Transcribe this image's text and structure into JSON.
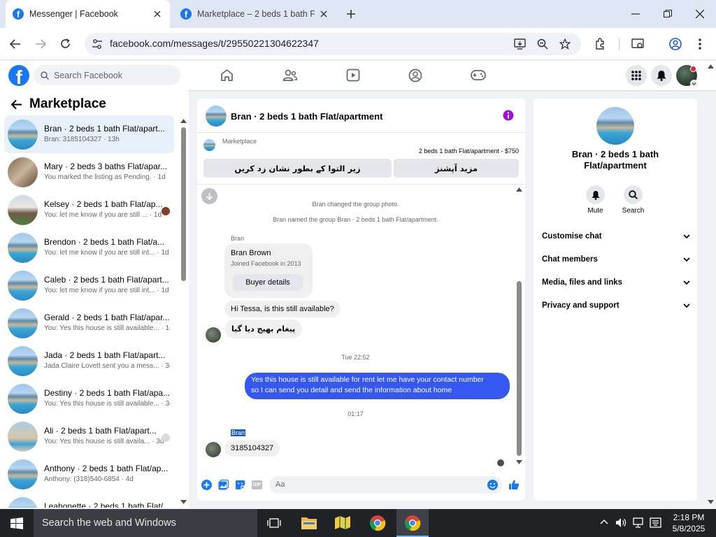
{
  "browser": {
    "tabs": [
      {
        "title": "Messenger | Facebook"
      },
      {
        "title": "Marketplace – 2 beds 1 bath Fla"
      }
    ],
    "url": "facebook.com/messages/t/29550221304622347"
  },
  "fb": {
    "search_placeholder": "Search Facebook",
    "logo_letter": "f"
  },
  "left": {
    "title": "Marketplace",
    "conversations": [
      {
        "name": "Bran · 2 beds 1 bath Flat/apart...",
        "snippet": "Bran: 3185104327 · 13h"
      },
      {
        "name": "Mary · 2 beds 3 baths Flat/apar...",
        "snippet": "You marked the listing as Pending. · 1d"
      },
      {
        "name": "Kelsey · 2 beds 1 bath Flat/ap...",
        "snippet": "You: let me know if you are still ... · 1d"
      },
      {
        "name": "Brendon · 2 beds 1 bath Flat/a...",
        "snippet": "You: let me know if you are still int... · 1d"
      },
      {
        "name": "Caleb · 2 beds 1 bath Flat/apart...",
        "snippet": "You: let me know if you are still int... · 1d"
      },
      {
        "name": "Gerald · 2 beds 1 bath Flat/apar...",
        "snippet": "You: Yes this house is still available... · 1d"
      },
      {
        "name": "Jada · 2 beds 1 bath Flat/apart...",
        "snippet": "Jada Claire Lovett sent you a mess... · 3d"
      },
      {
        "name": "Destiny · 2 beds 1 bath Flat/apa...",
        "snippet": "You: Yes this house is still available... · 3d"
      },
      {
        "name": "Ali · 2 beds 1 bath Flat/apart...",
        "snippet": "You: Yes this house is still availa... · 3d"
      },
      {
        "name": "Anthony · 2 beds 1 bath Flat/ap...",
        "snippet": "Anthony: (318)540-6854 · 4d"
      },
      {
        "name": "Leahonette · 2 beds 1 bath Flat/...",
        "snippet": ""
      }
    ]
  },
  "chat": {
    "title": "Bran · 2 beds 1 bath Flat/apartment",
    "listing_source": "Marketplace",
    "listing_line": "2 beds 1 bath Flat/apartment - $750",
    "btn_more_options": "مزید آپشنز",
    "btn_mark_pending": "زیر التوا کے بطور نشان زد کریں",
    "sys1": "Bran changed the group photo.",
    "sys2": "Bran named the group Bran · 2 beds 1 bath Flat/apartment.",
    "sender1": "Bran",
    "card_name": "Bran Brown",
    "card_sub": "Joined Facebook in 2013",
    "card_btn": "Buyer details",
    "msg1": "Hi Tessa, is this still available?",
    "msg2": "پیغام بھیج دیا گیا",
    "time1": "Tue 22:52",
    "msg3_line1": "Yes this house is still available for rent let me have your contact number",
    "msg3_line2": "so I can send you detail and send the information about home",
    "time2": "01:17",
    "sender2": "Bran",
    "msg4": "3185104327",
    "composer_placeholder": "Aa",
    "gif_label": "GIF"
  },
  "info": {
    "name_line1": "Bran · 2 beds 1 bath",
    "name_line2": "Flat/apartment",
    "mute": "Mute",
    "search": "Search",
    "rows": [
      "Customise chat",
      "Chat members",
      "Media, files and links",
      "Privacy and support"
    ]
  },
  "taskbar": {
    "search": "Search the web and Windows",
    "time": "2:18 PM",
    "date": "5/8/2025"
  },
  "colors": {
    "fb_blue": "#1877f2",
    "messenger_blue": "#3559f0",
    "purple_info": "#a20fcf"
  }
}
